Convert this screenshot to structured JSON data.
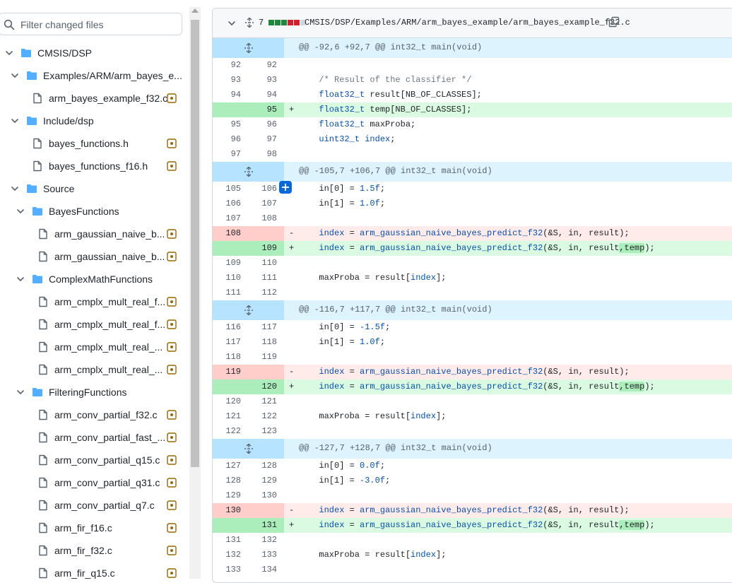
{
  "sidebar": {
    "filter_placeholder": "Filter changed files",
    "tree": [
      {
        "label": "CMSIS/DSP",
        "type": "folder"
      },
      {
        "label": "Examples/ARM/arm_bayes_e...",
        "type": "folder"
      },
      {
        "label": "arm_bayes_example_f32.c",
        "type": "file"
      },
      {
        "label": "Include/dsp",
        "type": "folder"
      },
      {
        "label": "bayes_functions.h",
        "type": "file"
      },
      {
        "label": "bayes_functions_f16.h",
        "type": "file"
      },
      {
        "label": "Source",
        "type": "folder"
      },
      {
        "label": "BayesFunctions",
        "type": "folder"
      },
      {
        "label": "arm_gaussian_naive_b...",
        "type": "file"
      },
      {
        "label": "arm_gaussian_naive_b...",
        "type": "file"
      },
      {
        "label": "ComplexMathFunctions",
        "type": "folder"
      },
      {
        "label": "arm_cmplx_mult_real_f...",
        "type": "file"
      },
      {
        "label": "arm_cmplx_mult_real_f...",
        "type": "file"
      },
      {
        "label": "arm_cmplx_mult_real_...",
        "type": "file"
      },
      {
        "label": "arm_cmplx_mult_real_...",
        "type": "file"
      },
      {
        "label": "FilteringFunctions",
        "type": "folder"
      },
      {
        "label": "arm_conv_partial_f32.c",
        "type": "file"
      },
      {
        "label": "arm_conv_partial_fast_...",
        "type": "file"
      },
      {
        "label": "arm_conv_partial_q15.c",
        "type": "file"
      },
      {
        "label": "arm_conv_partial_q31.c",
        "type": "file"
      },
      {
        "label": "arm_conv_partial_q7.c",
        "type": "file"
      },
      {
        "label": "arm_fir_f16.c",
        "type": "file"
      },
      {
        "label": "arm_fir_f32.c",
        "type": "file"
      },
      {
        "label": "arm_fir_q15.c",
        "type": "file"
      }
    ]
  },
  "file_header": {
    "changes_count": "7",
    "diffstat_colors": [
      "#1f883d",
      "#1f883d",
      "#1f883d",
      "#cf222e",
      "#cf222e",
      "#d0d7de"
    ],
    "file_path": "CMSIS/DSP/Examples/ARM/arm_bayes_example/arm_bayes_example_f32.c"
  },
  "hunks": [
    {
      "header": "@@ -92,6 +92,7 @@ int32_t main(void)"
    },
    {
      "header": "@@ -105,7 +106,7 @@ int32_t main(void)"
    },
    {
      "header": "@@ -116,7 +117,7 @@ int32_t main(void)"
    },
    {
      "header": "@@ -127,7 +128,7 @@ int32_t main(void)"
    }
  ],
  "lines": [
    {
      "old": "92",
      "new": "92",
      "sign": "",
      "code": ""
    },
    {
      "old": "93",
      "new": "93",
      "sign": "",
      "code": "  /* Result of the classifier */"
    },
    {
      "old": "94",
      "new": "94",
      "sign": "",
      "code": "  float32_t result[NB_OF_CLASSES];"
    },
    {
      "old": "",
      "new": "95",
      "sign": "+",
      "code": "  float32_t temp[NB_OF_CLASSES];"
    },
    {
      "old": "95",
      "new": "96",
      "sign": "",
      "code": "  float32_t maxProba;"
    },
    {
      "old": "96",
      "new": "97",
      "sign": "",
      "code": "  uint32_t index;"
    },
    {
      "old": "97",
      "new": "98",
      "sign": "",
      "code": ""
    },
    {
      "old": "105",
      "new": "106",
      "sign": "",
      "code": "  in[0] = 1.5f;"
    },
    {
      "old": "106",
      "new": "107",
      "sign": "",
      "code": "  in[1] = 1.0f;"
    },
    {
      "old": "107",
      "new": "108",
      "sign": "",
      "code": ""
    },
    {
      "old": "108",
      "new": "",
      "sign": "-",
      "code": "  index = arm_gaussian_naive_bayes_predict_f32(&S, in, result);"
    },
    {
      "old": "",
      "new": "109",
      "sign": "+",
      "code": "  index = arm_gaussian_naive_bayes_predict_f32(&S, in, result,temp);"
    },
    {
      "old": "109",
      "new": "110",
      "sign": "",
      "code": ""
    },
    {
      "old": "110",
      "new": "111",
      "sign": "",
      "code": "  maxProba = result[index];"
    },
    {
      "old": "111",
      "new": "112",
      "sign": "",
      "code": ""
    },
    {
      "old": "116",
      "new": "117",
      "sign": "",
      "code": "  in[0] = -1.5f;"
    },
    {
      "old": "117",
      "new": "118",
      "sign": "",
      "code": "  in[1] = 1.0f;"
    },
    {
      "old": "118",
      "new": "119",
      "sign": "",
      "code": ""
    },
    {
      "old": "119",
      "new": "",
      "sign": "-",
      "code": "  index = arm_gaussian_naive_bayes_predict_f32(&S, in, result);"
    },
    {
      "old": "",
      "new": "120",
      "sign": "+",
      "code": "  index = arm_gaussian_naive_bayes_predict_f32(&S, in, result,temp);"
    },
    {
      "old": "120",
      "new": "121",
      "sign": "",
      "code": ""
    },
    {
      "old": "121",
      "new": "122",
      "sign": "",
      "code": "  maxProba = result[index];"
    },
    {
      "old": "122",
      "new": "123",
      "sign": "",
      "code": ""
    },
    {
      "old": "127",
      "new": "128",
      "sign": "",
      "code": "  in[0] = 0.0f;"
    },
    {
      "old": "128",
      "new": "129",
      "sign": "",
      "code": "  in[1] = -3.0f;"
    },
    {
      "old": "129",
      "new": "130",
      "sign": "",
      "code": ""
    },
    {
      "old": "130",
      "new": "",
      "sign": "-",
      "code": "  index = arm_gaussian_naive_bayes_predict_f32(&S, in, result);"
    },
    {
      "old": "",
      "new": "131",
      "sign": "+",
      "code": "  index = arm_gaussian_naive_bayes_predict_f32(&S, in, result,temp);"
    },
    {
      "old": "131",
      "new": "132",
      "sign": "",
      "code": ""
    },
    {
      "old": "132",
      "new": "133",
      "sign": "",
      "code": "  maxProba = result[index];"
    },
    {
      "old": "133",
      "new": "134",
      "sign": "",
      "code": ""
    }
  ],
  "add_comment_label": "+",
  "icons": {
    "search": "search-icon",
    "chevron": "chevron-down-icon",
    "folder": "folder-icon",
    "file": "file-icon",
    "modified": "file-modified-icon",
    "expand": "unfold-icon",
    "copy": "copy-icon"
  },
  "colors": {
    "folder": "#54aeff",
    "modified_badge": "#9a6700",
    "addition_bg": "#dafbe1",
    "deletion_bg": "#ffebe9",
    "hunk_bg": "#ddf4ff",
    "accent": "#0969da"
  }
}
